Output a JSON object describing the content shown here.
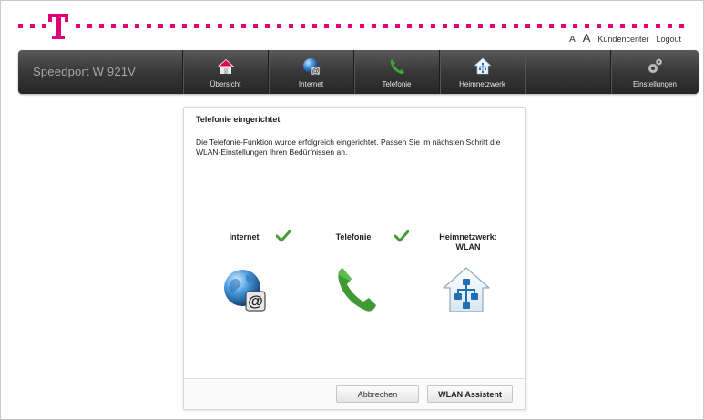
{
  "brand": {
    "logo_letter": "T",
    "accent_color": "#e20074"
  },
  "top_links": {
    "font_small": "A",
    "font_large": "A",
    "customer_center": "Kundencenter",
    "logout": "Logout"
  },
  "nav": {
    "device_name": "Speedport W 921V",
    "items": [
      {
        "label": "Übersicht",
        "icon": "home-icon"
      },
      {
        "label": "Internet",
        "icon": "globe-icon"
      },
      {
        "label": "Telefonie",
        "icon": "phone-icon"
      },
      {
        "label": "Heimnetzwerk",
        "icon": "home-network-icon"
      },
      {
        "label": "Einstellungen",
        "icon": "gears-icon"
      }
    ]
  },
  "panel": {
    "title": "Telefonie eingerichtet",
    "text": "Die Telefonie-Funktion wurde erfolgreich eingerichtet. Passen Sie im nächsten Schritt die WLAN-Einstellungen Ihren Bedürfnissen an.",
    "status": [
      {
        "label": "Internet",
        "done": true,
        "icon": "globe-icon"
      },
      {
        "label": "Telefonie",
        "done": true,
        "icon": "phone-icon"
      },
      {
        "label": "Heimnetzwerk: WLAN",
        "done": false,
        "icon": "home-network-icon"
      }
    ],
    "buttons": {
      "cancel": "Abbrechen",
      "wizard": "WLAN Assistent"
    }
  }
}
